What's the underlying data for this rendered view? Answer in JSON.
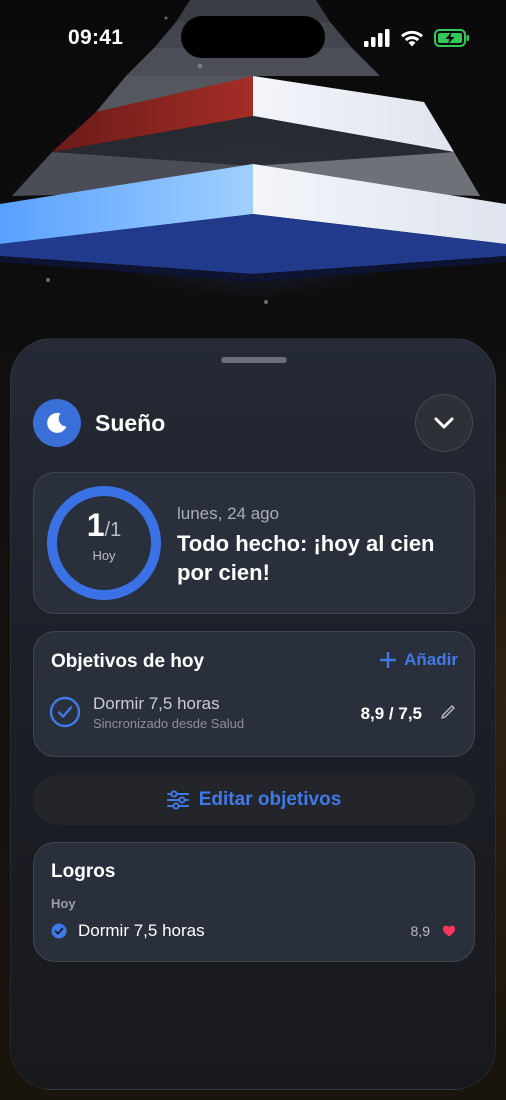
{
  "status_bar": {
    "time": "09:41",
    "icons": [
      "signal-icon",
      "wifi-icon",
      "battery-charging-icon"
    ],
    "battery_color": "#34c759"
  },
  "header": {
    "icon": "moon-icon",
    "title": "Sueño",
    "collapse_icon": "chevron-down-icon",
    "accent": "#3b6fd8"
  },
  "summary": {
    "completed": "1",
    "total": "1",
    "progress": 1.0,
    "ring_label": "Hoy",
    "date": "lunes, 24 ago",
    "message": "Todo hecho: ¡hoy al cien por cien!"
  },
  "goals": {
    "title": "Objetivos de hoy",
    "add_label": "Añadir",
    "items": [
      {
        "name": "Dormir 7,5 horas",
        "source": "Sincronizado desde Salud",
        "value": "8,9 / 7,5",
        "done": true
      }
    ]
  },
  "edit_goals": {
    "icon": "sliders-icon",
    "label": "Editar objetivos"
  },
  "achievements": {
    "title": "Logros",
    "section": "Hoy",
    "items": [
      {
        "name": "Dormir 7,5 horas",
        "value": "8,9",
        "icon": "heart-icon",
        "icon_color": "#ff375f"
      }
    ]
  }
}
